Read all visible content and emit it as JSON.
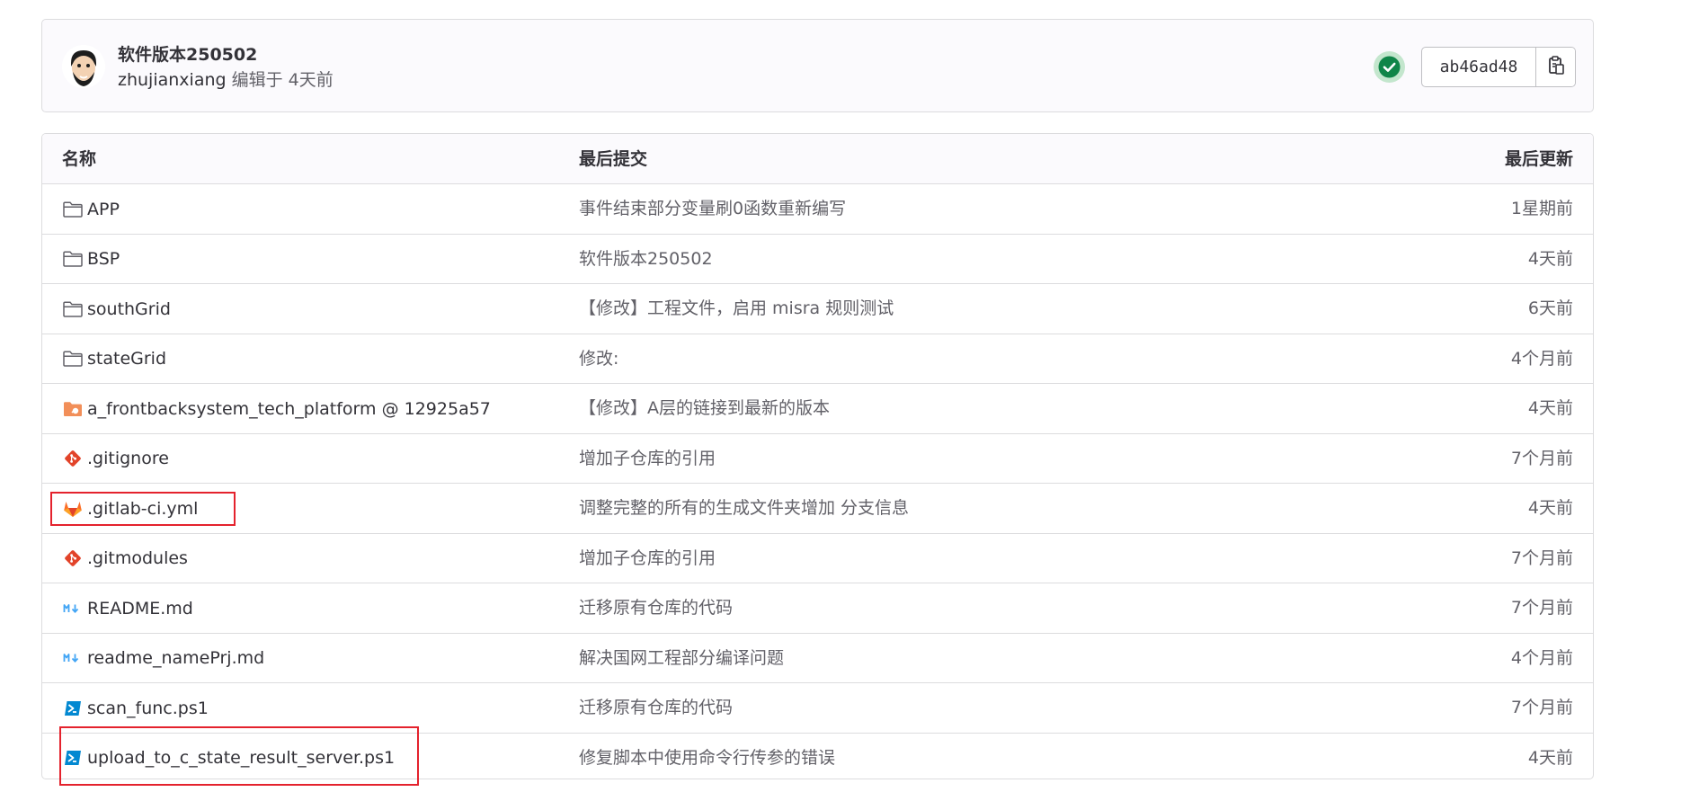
{
  "commit": {
    "title": "软件版本250502",
    "author": "zhujianxiang",
    "meta": " 编辑于 4天前",
    "sha": "ab46ad48",
    "pipeline_status": "success"
  },
  "tree": {
    "headers": {
      "name": "名称",
      "last_commit": "最后提交",
      "last_update": "最后更新"
    },
    "rows": [
      {
        "name": "APP",
        "icon": "folder-icon",
        "commit": "事件结束部分变量刷0函数重新编写",
        "updated": "1星期前"
      },
      {
        "name": "BSP",
        "icon": "folder-icon",
        "commit": "软件版本250502",
        "updated": "4天前"
      },
      {
        "name": "southGrid",
        "icon": "folder-icon",
        "commit": "【修改】工程文件，启用 misra 规则测试",
        "updated": "6天前"
      },
      {
        "name": "stateGrid",
        "icon": "folder-icon",
        "commit": "修改:",
        "updated": "4个月前"
      },
      {
        "name": "a_frontbacksystem_tech_platform @ 12925a57",
        "icon": "submodule-icon",
        "commit": "【修改】A层的链接到最新的版本",
        "updated": "4天前"
      },
      {
        "name": ".gitignore",
        "icon": "git-icon",
        "commit": "增加子仓库的引用",
        "updated": "7个月前"
      },
      {
        "name": ".gitlab-ci.yml",
        "icon": "gitlab-icon",
        "commit": "调整完整的所有的生成文件夹增加 分支信息",
        "updated": "4天前"
      },
      {
        "name": ".gitmodules",
        "icon": "git-icon",
        "commit": "增加子仓库的引用",
        "updated": "7个月前"
      },
      {
        "name": "README.md",
        "icon": "markdown-icon",
        "commit": "迁移原有仓库的代码",
        "updated": "7个月前"
      },
      {
        "name": "readme_namePrj.md",
        "icon": "markdown-icon",
        "commit": "解决国网工程部分编译问题",
        "updated": "4个月前"
      },
      {
        "name": "scan_func.ps1",
        "icon": "powershell-icon",
        "commit": "迁移原有仓库的代码",
        "updated": "7个月前"
      },
      {
        "name": "upload_to_c_state_result_server.ps1",
        "icon": "powershell-icon",
        "commit": "修复脚本中使用命令行传参的错误",
        "updated": "4天前"
      }
    ]
  },
  "colors": {
    "success": "#108548",
    "success_bg": "#c3e6cd",
    "highlight": "#e4222d",
    "git": "#e24329",
    "gitlab": "#fc6d26",
    "markdown": "#42a5f5",
    "powershell": "#0288d1",
    "submodule": "#f28f59"
  }
}
